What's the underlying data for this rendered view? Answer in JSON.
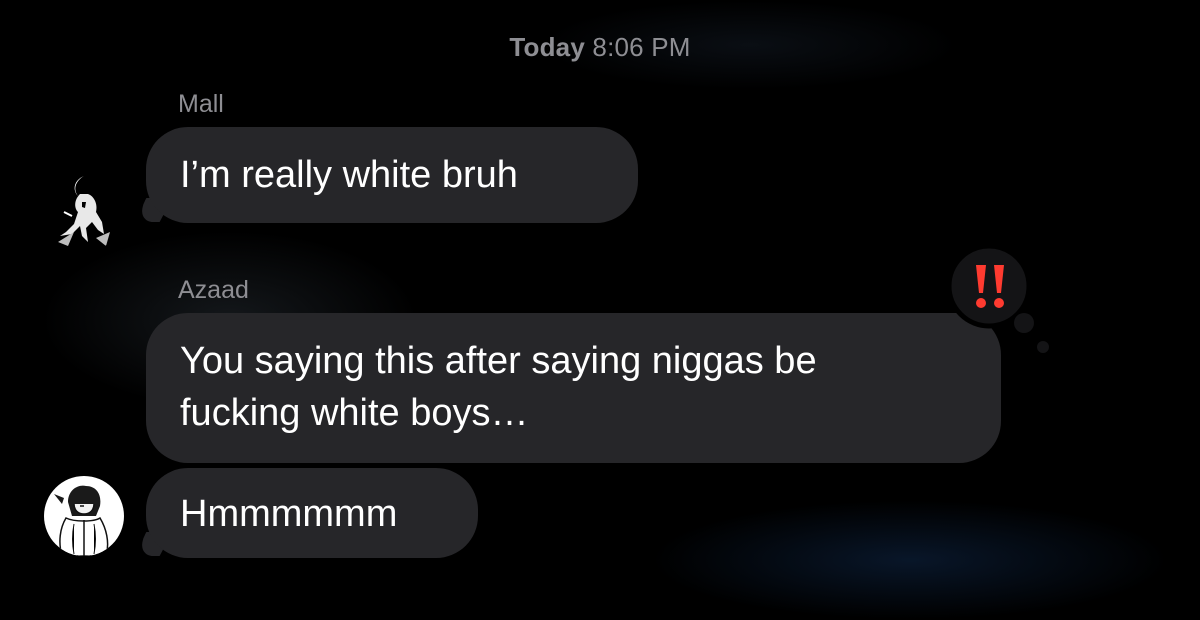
{
  "timestamp": {
    "day": "Today",
    "time": "8:06 PM"
  },
  "messages": [
    {
      "sender": "Mall",
      "text": "I’m really white bruh",
      "avatar_icon": "anime-character-avatar-icon"
    },
    {
      "sender": "Azaad",
      "lines": [
        "You saying this after saying niggas be",
        "fucking white boys…"
      ],
      "tapback_icon": "double-exclamation-icon"
    },
    {
      "text": "Hmmmmmm",
      "avatar_icon": "anime-character-avatar-icon"
    }
  ],
  "colors": {
    "background": "#000000",
    "bubble": "#262629",
    "meta_text": "#8e8e93",
    "tapback_accent": "#ff3b30"
  }
}
